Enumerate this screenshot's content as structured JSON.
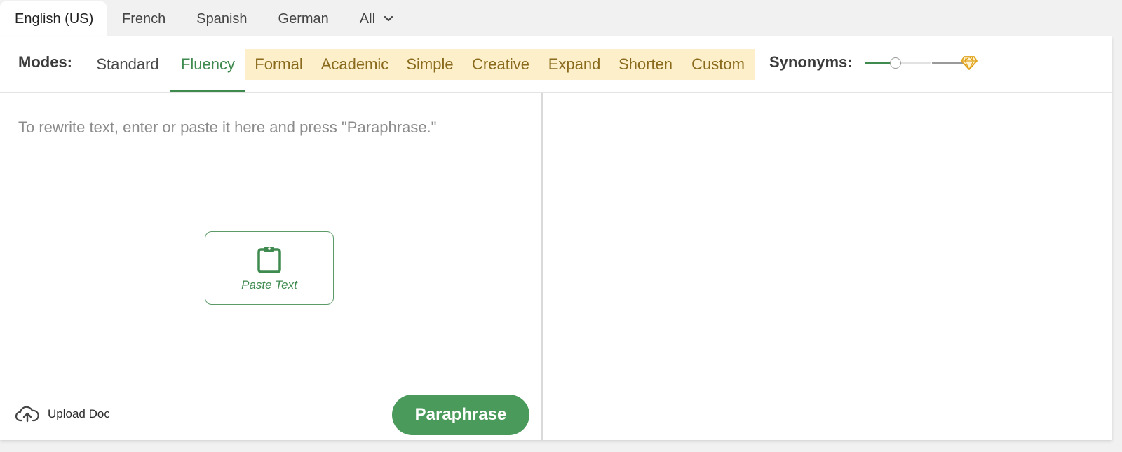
{
  "languages": {
    "tabs": [
      "English (US)",
      "French",
      "Spanish",
      "German",
      "All"
    ],
    "active": "English (US)"
  },
  "modes": {
    "label": "Modes:",
    "items": [
      "Standard",
      "Fluency",
      "Formal",
      "Academic",
      "Simple",
      "Creative",
      "Expand",
      "Shorten",
      "Custom"
    ],
    "selected": "Fluency",
    "premium": [
      "Formal",
      "Academic",
      "Simple",
      "Creative",
      "Expand",
      "Shorten",
      "Custom"
    ]
  },
  "synonyms": {
    "label": "Synonyms:",
    "level_fraction": 0.3
  },
  "editor": {
    "placeholder": "To rewrite text, enter or paste it here and press \"Paraphrase.\"",
    "paste_label": "Paste Text",
    "upload_label": "Upload Doc",
    "paraphrase_label": "Paraphrase"
  },
  "colors": {
    "accent_green": "#3e8a4f",
    "button_green": "#4a9a5b",
    "premium_bg": "#fcefc9",
    "premium_text": "#8a6a1c",
    "diamond": "#e0a21a"
  },
  "icons": {
    "chevron": "chevron-down-icon",
    "clipboard": "clipboard-icon",
    "upload": "cloud-upload-icon",
    "premium": "diamond-icon"
  }
}
